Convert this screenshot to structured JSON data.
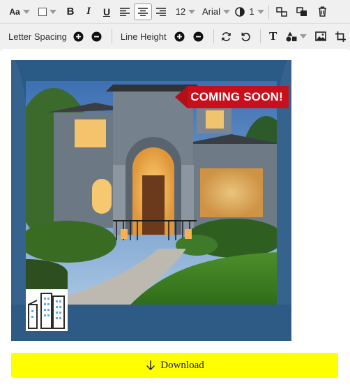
{
  "toolbar_top": {
    "font_size_label": "Aa",
    "font_size_value": "12",
    "font_family": "Arial",
    "opacity_value": "1",
    "icons": [
      "text-size-icon",
      "color-swatch-icon",
      "bold-icon",
      "italic-icon",
      "underline-icon",
      "align-left-icon",
      "align-center-icon",
      "align-right-icon",
      "opacity-icon",
      "arrange-icon",
      "layers-icon",
      "trash-icon"
    ],
    "bold_label": "B",
    "italic_label": "I",
    "underline_label": "U"
  },
  "toolbar_bottom": {
    "letter_spacing_label": "Letter Spacing",
    "line_height_label": "Line Height",
    "text_tool_label": "T",
    "icons": [
      "plus-circle-icon",
      "minus-circle-icon",
      "refresh-icon",
      "undo-icon",
      "text-icon",
      "shapes-icon",
      "image-icon",
      "crop-icon"
    ]
  },
  "design": {
    "badge_text": "COMING SOON!",
    "colors": {
      "background": "#2a5a86",
      "badge": "#c8101c",
      "download": "#ffff00"
    }
  },
  "download": {
    "label": "Download"
  }
}
